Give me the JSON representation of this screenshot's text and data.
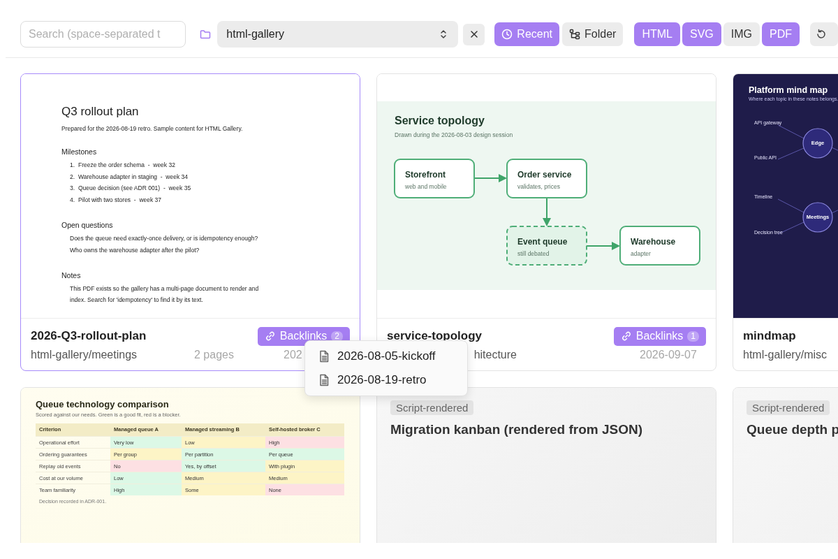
{
  "toolbar": {
    "search": {
      "placeholder": "Search (space-separated t"
    },
    "folder_select": {
      "value": "html-gallery"
    },
    "sort": [
      {
        "label": "Recent",
        "selected": true
      },
      {
        "label": "Folder",
        "selected": false
      }
    ],
    "types": [
      {
        "label": "HTML",
        "on": true
      },
      {
        "label": "SVG",
        "on": true
      },
      {
        "label": "IMG",
        "on": false
      },
      {
        "label": "PDF",
        "on": true
      }
    ]
  },
  "cards": [
    {
      "selected": true,
      "thumbnail": {
        "kind": "document",
        "title": "Q3 rollout plan",
        "intro": "Prepared for the 2026-08-19 retro. Sample content for HTML Gallery.",
        "sections": [
          {
            "heading": "Milestones",
            "items": [
              {
                "num": "1.",
                "text": "Freeze the order schema  -  week 32"
              },
              {
                "num": "2.",
                "text": "Warehouse adapter in staging  -  week 34"
              },
              {
                "num": "3.",
                "text": "Queue decision (see ADR 001)  -  week 35"
              },
              {
                "num": "4.",
                "text": "Pilot with two stores  -  week 37"
              }
            ]
          },
          {
            "heading": "Open questions",
            "lines": [
              "Does the queue need exactly-once delivery, or is idempotency enough?",
              "Who owns the warehouse adapter after the pilot?"
            ]
          },
          {
            "heading": "Notes",
            "paragraph": "This PDF exists so the gallery has a multi-page document to render and index. Search for 'idempotency' to find it by its text."
          }
        ]
      },
      "footer": {
        "title": "2026-Q3-rollout-plan",
        "path": "html-gallery/meetings",
        "pages": "2 pages",
        "date": "202",
        "backlinks": {
          "label": "Backlinks",
          "count": "2"
        }
      }
    },
    {
      "selected": false,
      "thumbnail": {
        "kind": "diagram",
        "title": "Service topology",
        "subtitle": "Drawn during the 2026-08-03 design session",
        "nodes": [
          {
            "title": "Storefront",
            "subtitle": "web and mobile",
            "dashed": false
          },
          {
            "title": "Order service",
            "subtitle": "validates, prices",
            "dashed": false
          },
          {
            "title": "Event queue",
            "subtitle": "still debated",
            "dashed": true
          },
          {
            "title": "Warehouse",
            "subtitle": "adapter",
            "dashed": false
          }
        ]
      },
      "footer": {
        "title": "service-topology",
        "path": "hitecture",
        "path_cut": true,
        "date": "2026-09-07",
        "backlinks": {
          "label": "Backlinks",
          "count": "1"
        }
      }
    },
    {
      "selected": false,
      "thumbnail": {
        "kind": "mindmap",
        "title": "Platform mind map",
        "subtitle": "Where each topic in these notes belongs.",
        "topics": [
          {
            "label": "Edge",
            "children": [
              {
                "label": "API gateway"
              },
              {
                "label": "Public API"
              }
            ]
          },
          {
            "label": "Meetings",
            "children": [
              {
                "label": "Timeline"
              },
              {
                "label": "Decision tree"
              }
            ]
          }
        ]
      },
      "footer": {
        "title": "mindmap",
        "path": "html-gallery/misc"
      }
    },
    {
      "selected": false,
      "thumbnail": {
        "kind": "table",
        "title": "Queue technology comparison",
        "subtitle": "Scored against our needs. Green is a good fit, red is a blocker.",
        "columns": [
          "Criterion",
          "Managed queue A",
          "Managed streaming B",
          "Self-hosted broker C"
        ],
        "rows": [
          {
            "cells": [
              {
                "text": "Operational effort"
              },
              {
                "text": "Very low",
                "color": "#dcf8e6"
              },
              {
                "text": "Low",
                "color": "#fdf4c6"
              },
              {
                "text": "High",
                "color": "#fde0e3"
              }
            ]
          },
          {
            "cells": [
              {
                "text": "Ordering guarantees"
              },
              {
                "text": "Per group",
                "color": "#fdf4c6"
              },
              {
                "text": "Per partition",
                "color": "#dcf8e6"
              },
              {
                "text": "Per queue",
                "color": "#dcf8e6"
              }
            ]
          },
          {
            "cells": [
              {
                "text": "Replay old events"
              },
              {
                "text": "No",
                "color": "#fde0e3"
              },
              {
                "text": "Yes, by offset",
                "color": "#dcf8e6"
              },
              {
                "text": "With plugin",
                "color": "#fdf4c6"
              }
            ]
          },
          {
            "cells": [
              {
                "text": "Cost at our volume"
              },
              {
                "text": "Low",
                "color": "#dcf8e6"
              },
              {
                "text": "Medium",
                "color": "#fdf4c6"
              },
              {
                "text": "Medium",
                "color": "#fdf4c6"
              }
            ]
          },
          {
            "cells": [
              {
                "text": "Team familiarity"
              },
              {
                "text": "High",
                "color": "#dcf8e6"
              },
              {
                "text": "Some",
                "color": "#fdf4c6"
              },
              {
                "text": "None",
                "color": "#fde0e3"
              }
            ]
          }
        ],
        "footnote": "Decision recorded in ADR-001."
      }
    },
    {
      "selected": false,
      "thumbnail": {
        "kind": "script",
        "tag": "Script-rendered",
        "title": "Migration kanban (rendered from JSON)"
      }
    },
    {
      "selected": false,
      "thumbnail": {
        "kind": "script",
        "tag": "Script-rendered",
        "title": "Queue depth p"
      }
    }
  ],
  "backlinks_menu": {
    "items": [
      "2026-08-05-kickoff",
      "2026-08-19-retro"
    ]
  }
}
